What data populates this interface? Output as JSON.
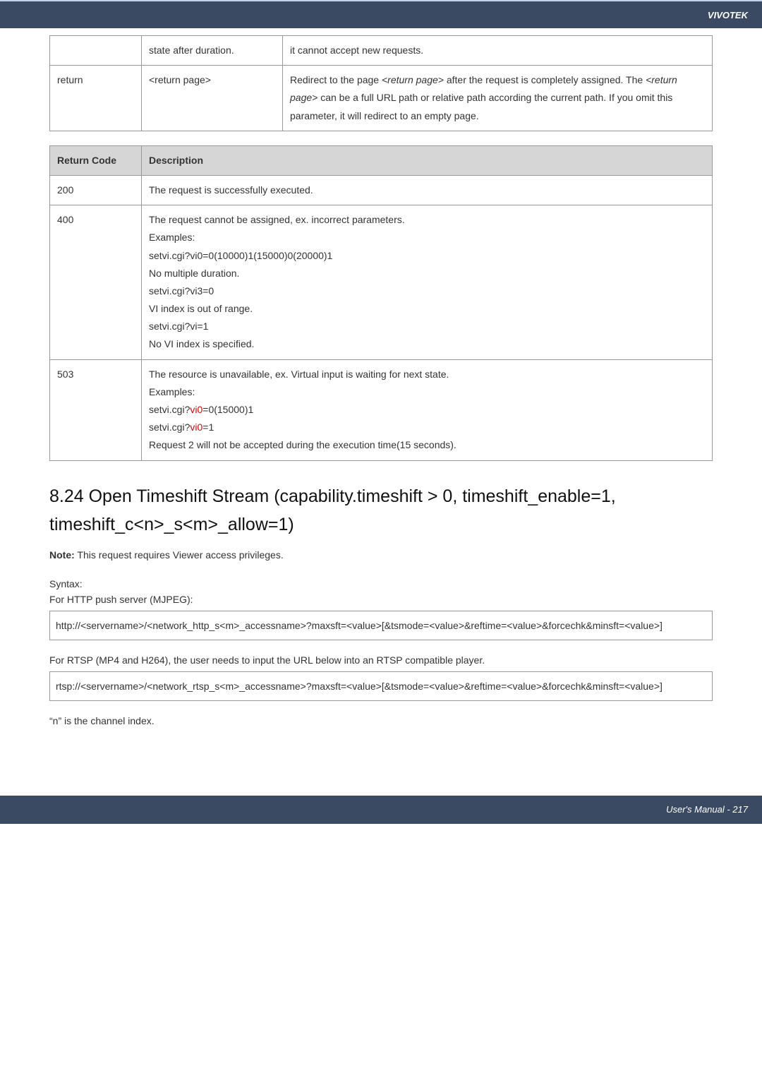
{
  "header": {
    "brand": "VIVOTEK"
  },
  "table1": {
    "row0": {
      "c1": "state after duration.",
      "c2": "it cannot accept new requests."
    },
    "row1": {
      "c0": "return",
      "c1": "<return page>",
      "c2a": "Redirect to the page ",
      "c2b": "<return page>",
      "c2c": " after the request is completely assigned. The ",
      "c2d": "<return page>",
      "c2e": " can be a full URL path or relative path according the current path. If you omit this parameter, it will redirect to an empty page."
    }
  },
  "table2": {
    "h0": "Return Code",
    "h1": "Description",
    "r200": "200",
    "r200d": "The request is successfully executed.",
    "r400": "400",
    "r400l0": "The request cannot be assigned, ex. incorrect parameters.",
    "r400l1": "Examples:",
    "r400l2": "setvi.cgi?vi0=0(10000)1(15000)0(20000)1",
    "r400l3": "No multiple duration.",
    "r400l4": "setvi.cgi?vi3=0",
    "r400l5": "VI index is out of range.",
    "r400l6": "setvi.cgi?vi=1",
    "r400l7": "No VI index is specified.",
    "r503": "503",
    "r503l0": "The resource is unavailable, ex. Virtual input is waiting for next state.",
    "r503l1": "Examples:",
    "r503l2a": "setvi.cgi?",
    "r503l2b": "vi0",
    "r503l2c": "=0(15000)1",
    "r503l3a": "setvi.cgi?",
    "r503l3b": "vi0",
    "r503l3c": "=1",
    "r503l4": "Request 2 will not be accepted during the execution time(15 seconds)."
  },
  "section": {
    "title": "8.24 Open Timeshift Stream (capability.timeshift > 0, timeshift_enable=1, timeshift_c<n>_s<m>_allow=1)",
    "noteLabel": "Note:",
    "noteText": " This request requires Viewer access privileges.",
    "syntaxLabel": "Syntax:",
    "httpLabel": "For HTTP push server (MJPEG):",
    "httpCode": "http://<servername>/<network_http_s<m>_accessname>?maxsft=<value>[&tsmode=<value>&reftime=<value>&forcechk&minsft=<value>]",
    "rtspLabel": "For RTSP (MP4 and H264), the user needs to input the URL below into an RTSP compatible player.",
    "rtspCode": "rtsp://<servername>/<network_rtsp_s<m>_accessname>?maxsft=<value>[&tsmode=<value>&reftime=<value>&forcechk&minsft=<value>]",
    "channelNote": "“n” is the channel index."
  },
  "footer": {
    "text": "User's Manual - 217"
  }
}
